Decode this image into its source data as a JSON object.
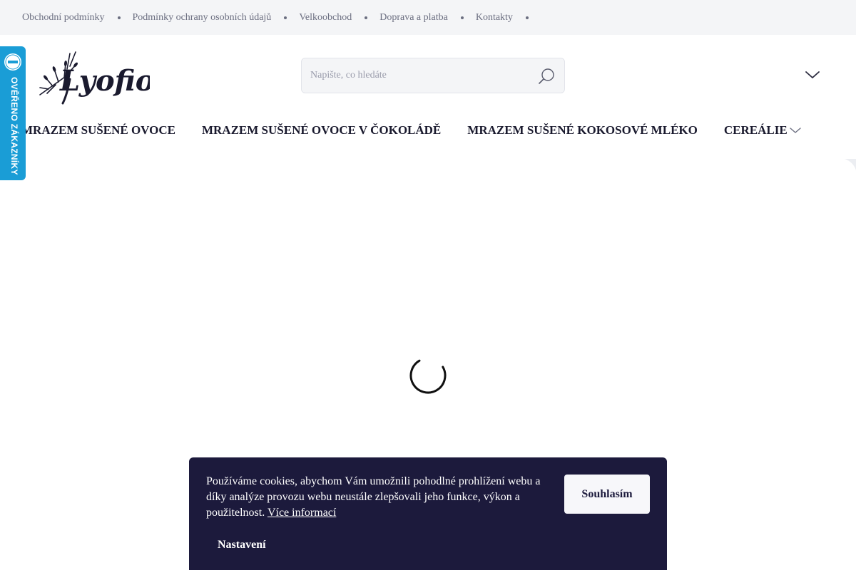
{
  "topbar": {
    "links": [
      "Obchodní podmínky",
      "Podmínky ochrany osobních údajů",
      "Velkoobchod",
      "Doprava a platba",
      "Kontakty"
    ]
  },
  "header": {
    "logo_text": "Lyofio",
    "search_placeholder": "Napište, co hledáte"
  },
  "mainnav": {
    "items": [
      "MRAZEM SUŠENÉ OVOCE",
      "MRAZEM SUŠENÉ OVOCE V ČOKOLÁDĚ",
      "MRAZEM SUŠENÉ KOKOSOVÉ MLÉKO",
      "CEREÁLIE"
    ]
  },
  "badge": {
    "label": "OVĚŘENO ZÁKAZNÍKY"
  },
  "cookie": {
    "text": "Používáme cookies, abychom Vám umožnili pohodlné prohlížení webu a díky analýze provozu webu neustále zlepšovali jeho funkce, výkon a použitelnost.",
    "more_link": "Více informací",
    "agree_label": "Souhlasím",
    "settings_label": "Nastavení"
  },
  "colors": {
    "topbar_bg": "#f4f5f7",
    "badge_blue": "#1a9dd6",
    "cookie_bg": "#1c1a3c",
    "text_dark": "#1a1a2e"
  }
}
